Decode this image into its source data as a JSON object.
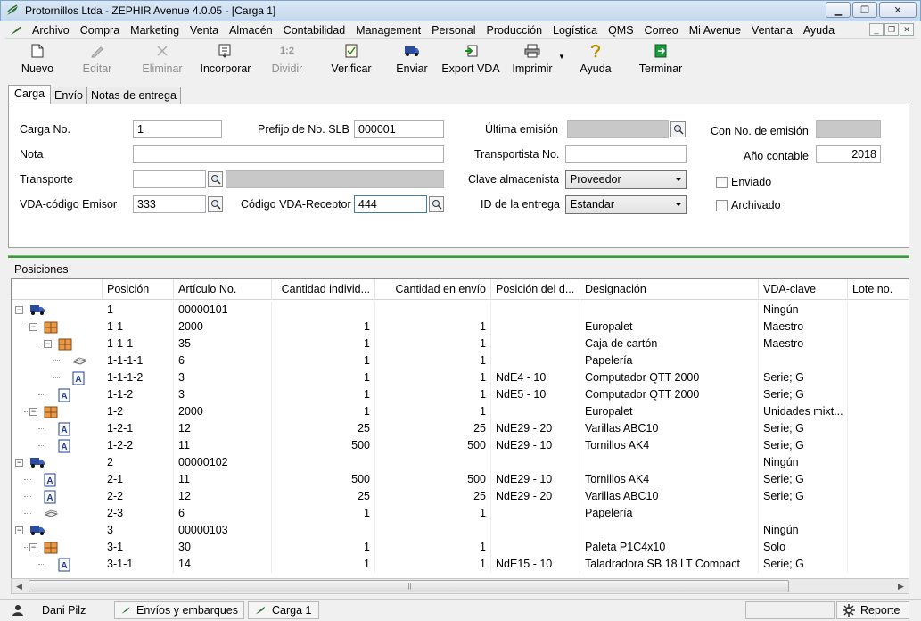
{
  "window": {
    "title": "Protornillos Ltda - ZEPHIR Avenue 4.0.05 - [Carga 1]",
    "controls": [
      "minimize",
      "maximize",
      "close"
    ]
  },
  "menu": [
    "Archivo",
    "Compra",
    "Marketing",
    "Venta",
    "Almacén",
    "Contabilidad",
    "Management",
    "Personal",
    "Producción",
    "Logística",
    "QMS",
    "Correo",
    "Mi Avenue",
    "Ventana",
    "Ayuda"
  ],
  "toolbar": {
    "nuevo": "Nuevo",
    "editar": "Editar",
    "eliminar": "Eliminar",
    "incorporar": "Incorporar",
    "dividir": "Dividir",
    "verificar": "Verificar",
    "enviar": "Enviar",
    "export_vda": "Export VDA",
    "imprimir": "Imprimir",
    "ayuda": "Ayuda",
    "terminar": "Terminar",
    "dividir_icon_text": "1:2"
  },
  "tabs": [
    "Carga",
    "Envío",
    "Notas de entrega"
  ],
  "form": {
    "carga_no_label": "Carga No.",
    "carga_no": "1",
    "prefijo_label": "Prefijo de No. SLB",
    "prefijo": "000001",
    "ultima_emision_label": "Última emisión",
    "con_no_emision_label": "Con No. de emisión",
    "nota_label": "Nota",
    "nota": "",
    "transportista_label": "Transportista No.",
    "transportista": "",
    "anio_contable_label": "Año contable",
    "anio_contable": "2018",
    "transporte_label": "Transporte",
    "transporte": "",
    "clave_almacenista_label": "Clave almacenista",
    "clave_almacenista": "Proveedor",
    "enviado_label": "Enviado",
    "enviado_checked": false,
    "vda_emisor_label": "VDA-código Emisor",
    "vda_emisor": "333",
    "vda_receptor_label": "Código VDA-Receptor",
    "vda_receptor": "444",
    "id_entrega_label": "ID de la entrega",
    "id_entrega": "Estandar",
    "archivado_label": "Archivado",
    "archivado_checked": false
  },
  "positions": {
    "section_label": "Posiciones",
    "columns": [
      "Posición",
      "Artículo No.",
      "Cantidad individ...",
      "Cantidad en envío",
      "Posición del d...",
      "Designación",
      "VDA-clave",
      "Lote no."
    ],
    "rows": [
      {
        "icon": "truck-icon",
        "pos": "1",
        "art": "00000101",
        "qty": "",
        "qty_env": "",
        "pos_del": "",
        "desig": "",
        "vda": "Ningún",
        "lote": ""
      },
      {
        "icon": "pallet-icon",
        "pos": "1-1",
        "art": "2000",
        "qty": "1",
        "qty_env": "1",
        "pos_del": "",
        "desig": "Europalet",
        "vda": "Maestro",
        "lote": ""
      },
      {
        "icon": "pallet-icon",
        "pos": "1-1-1",
        "art": "35",
        "qty": "1",
        "qty_env": "1",
        "pos_del": "",
        "desig": "Caja de cartón",
        "vda": "Maestro",
        "lote": ""
      },
      {
        "icon": "paper-icon",
        "pos": "1-1-1-1",
        "art": "6",
        "qty": "1",
        "qty_env": "1",
        "pos_del": "",
        "desig": "Papelería",
        "vda": "",
        "lote": ""
      },
      {
        "icon": "article-icon",
        "pos": "1-1-1-2",
        "art": "3",
        "qty": "1",
        "qty_env": "1",
        "pos_del": "NdE4 - 10",
        "desig": "Computador QTT 2000",
        "vda": "Serie; G",
        "lote": ""
      },
      {
        "icon": "article-icon",
        "pos": "1-1-2",
        "art": "3",
        "qty": "1",
        "qty_env": "1",
        "pos_del": "NdE5 - 10",
        "desig": "Computador QTT 2000",
        "vda": "Serie; G",
        "lote": ""
      },
      {
        "icon": "pallet-icon",
        "pos": "1-2",
        "art": "2000",
        "qty": "1",
        "qty_env": "1",
        "pos_del": "",
        "desig": "Europalet",
        "vda": "Unidades mixt...",
        "lote": ""
      },
      {
        "icon": "article-icon",
        "pos": "1-2-1",
        "art": "12",
        "qty": "25",
        "qty_env": "25",
        "pos_del": "NdE29 - 20",
        "desig": "Varillas  ABC10",
        "vda": "Serie; G",
        "lote": ""
      },
      {
        "icon": "article-icon",
        "pos": "1-2-2",
        "art": "11",
        "qty": "500",
        "qty_env": "500",
        "pos_del": "NdE29 - 10",
        "desig": "Tornillos AK4",
        "vda": "Serie; G",
        "lote": ""
      },
      {
        "icon": "truck-icon",
        "pos": "2",
        "art": "00000102",
        "qty": "",
        "qty_env": "",
        "pos_del": "",
        "desig": "",
        "vda": "Ningún",
        "lote": ""
      },
      {
        "icon": "article-icon",
        "pos": "2-1",
        "art": "11",
        "qty": "500",
        "qty_env": "500",
        "pos_del": "NdE29 - 10",
        "desig": "Tornillos AK4",
        "vda": "Serie; G",
        "lote": ""
      },
      {
        "icon": "article-icon",
        "pos": "2-2",
        "art": "12",
        "qty": "25",
        "qty_env": "25",
        "pos_del": "NdE29 - 20",
        "desig": "Varillas  ABC10",
        "vda": "Serie; G",
        "lote": ""
      },
      {
        "icon": "paper-icon",
        "pos": "2-3",
        "art": "6",
        "qty": "1",
        "qty_env": "1",
        "pos_del": "",
        "desig": "Papelería",
        "vda": "",
        "lote": ""
      },
      {
        "icon": "truck-icon",
        "pos": "3",
        "art": "00000103",
        "qty": "",
        "qty_env": "",
        "pos_del": "",
        "desig": "",
        "vda": "Ningún",
        "lote": ""
      },
      {
        "icon": "pallet-icon",
        "pos": "3-1",
        "art": "30",
        "qty": "1",
        "qty_env": "1",
        "pos_del": "",
        "desig": "Paleta P1C4x10",
        "vda": "Solo",
        "lote": ""
      },
      {
        "icon": "article-icon",
        "pos": "3-1-1",
        "art": "14",
        "qty": "1",
        "qty_env": "1",
        "pos_del": "NdE15 - 10",
        "desig": "Taladradora SB 18 LT Compact",
        "vda": "Serie; G",
        "lote": ""
      }
    ]
  },
  "statusbar": {
    "user": "Dani Pilz",
    "module": "Envíos y embarques",
    "window": "Carga 1",
    "report": "Reporte"
  }
}
